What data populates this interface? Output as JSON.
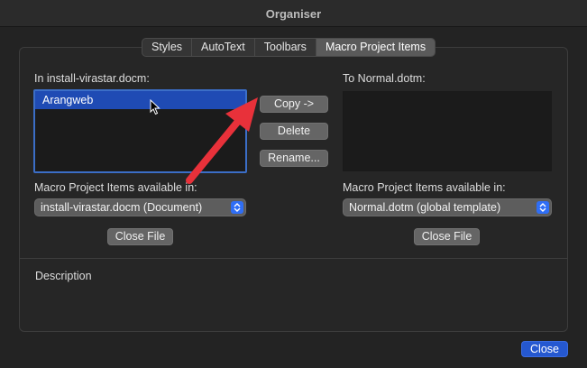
{
  "window": {
    "title": "Organiser"
  },
  "tabs": [
    {
      "label": "Styles",
      "active": false
    },
    {
      "label": "AutoText",
      "active": false
    },
    {
      "label": "Toolbars",
      "active": false
    },
    {
      "label": "Macro Project Items",
      "active": true
    }
  ],
  "left": {
    "heading": "In install-virastar.docm:",
    "items": [
      {
        "label": "Arangweb",
        "selected": true
      }
    ],
    "available_label": "Macro Project Items available in:",
    "available_value": "install-virastar.docm (Document)",
    "close_file_label": "Close File"
  },
  "right": {
    "heading": "To Normal.dotm:",
    "items": [],
    "available_label": "Macro Project Items available in:",
    "available_value": "Normal.dotm (global template)",
    "close_file_label": "Close File"
  },
  "actions": {
    "copy_label": "Copy ->",
    "delete_label": "Delete",
    "rename_label": "Rename..."
  },
  "description": {
    "label": "Description"
  },
  "footer": {
    "close_label": "Close"
  },
  "colors": {
    "accent": "#2558d0",
    "selection": "#1f4bb4",
    "annotation_arrow": "#e8313a"
  },
  "icons": {
    "pointer": "mouse-pointer-icon",
    "annotation": "red-arrow-icon",
    "stepper": "chevron-up-down-icon"
  }
}
